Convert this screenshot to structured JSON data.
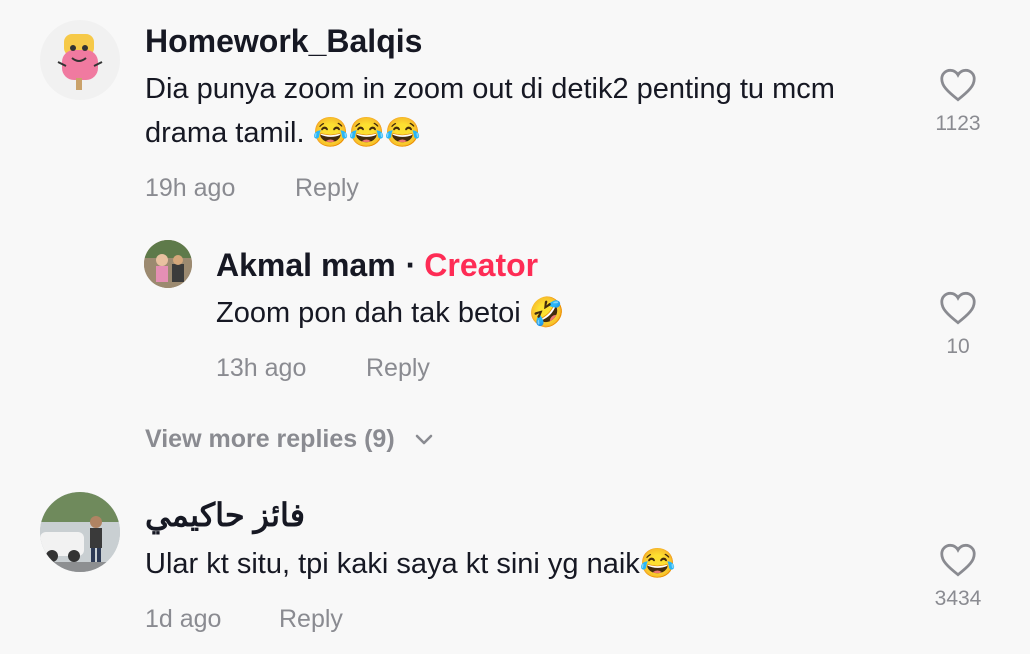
{
  "comments": [
    {
      "username": "Homework_Balqis",
      "text": "Dia punya zoom in zoom out di detik2 penting tu mcm drama tamil. 😂😂😂",
      "time": "19h ago",
      "reply_label": "Reply",
      "likes": "1123",
      "avatar_icon": "popsicle-cartoon-avatar"
    },
    {
      "username": "Akmal mam",
      "separator": "·",
      "badge": "Creator",
      "text": "Zoom pon dah tak betoi 🤣",
      "time": "13h ago",
      "reply_label": "Reply",
      "likes": "10",
      "avatar_icon": "child-photo-avatar"
    },
    {
      "username": "فائز حاكيمي",
      "text": "Ular kt situ, tpi kaki saya kt sini yg naik😂",
      "time": "1d ago",
      "reply_label": "Reply",
      "likes": "3434",
      "avatar_icon": "street-photo-avatar"
    }
  ],
  "view_more_replies": "View more replies (9)",
  "colors": {
    "background": "#f8f8f8",
    "text": "#161823",
    "muted": "#8a8b91",
    "creator": "#fe2c55"
  }
}
